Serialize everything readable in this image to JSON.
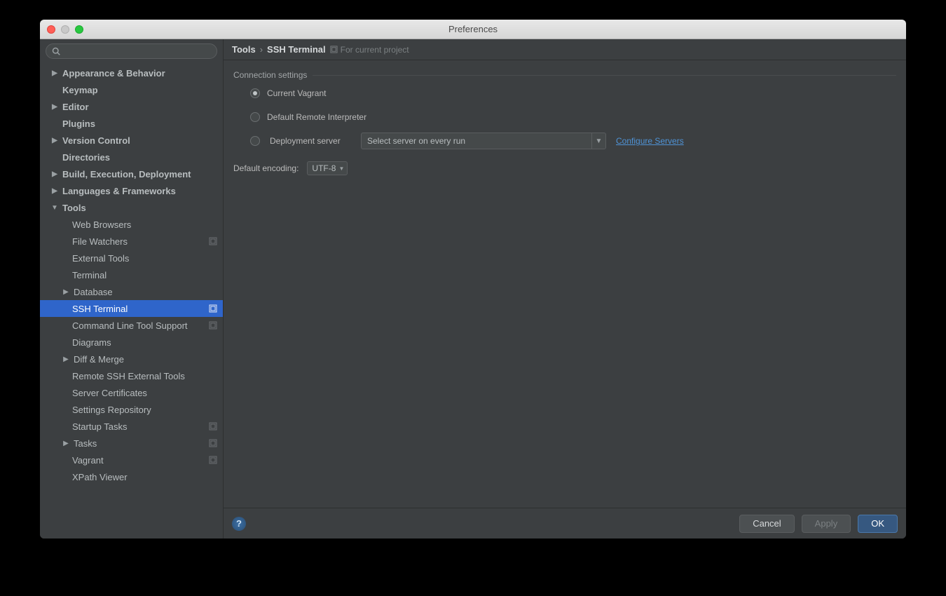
{
  "window": {
    "title": "Preferences"
  },
  "search": {
    "placeholder": ""
  },
  "sidebar": {
    "items": [
      {
        "label": "Appearance & Behavior"
      },
      {
        "label": "Keymap"
      },
      {
        "label": "Editor"
      },
      {
        "label": "Plugins"
      },
      {
        "label": "Version Control"
      },
      {
        "label": "Directories"
      },
      {
        "label": "Build, Execution, Deployment"
      },
      {
        "label": "Languages & Frameworks"
      },
      {
        "label": "Tools"
      }
    ],
    "tools_children": [
      {
        "label": "Web Browsers"
      },
      {
        "label": "File Watchers"
      },
      {
        "label": "External Tools"
      },
      {
        "label": "Terminal"
      },
      {
        "label": "Database"
      },
      {
        "label": "SSH Terminal"
      },
      {
        "label": "Command Line Tool Support"
      },
      {
        "label": "Diagrams"
      },
      {
        "label": "Diff & Merge"
      },
      {
        "label": "Remote SSH External Tools"
      },
      {
        "label": "Server Certificates"
      },
      {
        "label": "Settings Repository"
      },
      {
        "label": "Startup Tasks"
      },
      {
        "label": "Tasks"
      },
      {
        "label": "Vagrant"
      },
      {
        "label": "XPath Viewer"
      }
    ]
  },
  "breadcrumb": {
    "root": "Tools",
    "leaf": "SSH Terminal",
    "hint": "For current project"
  },
  "connection": {
    "legend": "Connection settings",
    "opt_current_vagrant": "Current Vagrant",
    "opt_default_remote": "Default Remote Interpreter",
    "opt_deployment": "Deployment server",
    "deployment_value": "Select server on every run",
    "configure_link": "Configure Servers"
  },
  "encoding": {
    "label": "Default encoding:",
    "value": "UTF-8"
  },
  "buttons": {
    "cancel": "Cancel",
    "apply": "Apply",
    "ok": "OK"
  }
}
